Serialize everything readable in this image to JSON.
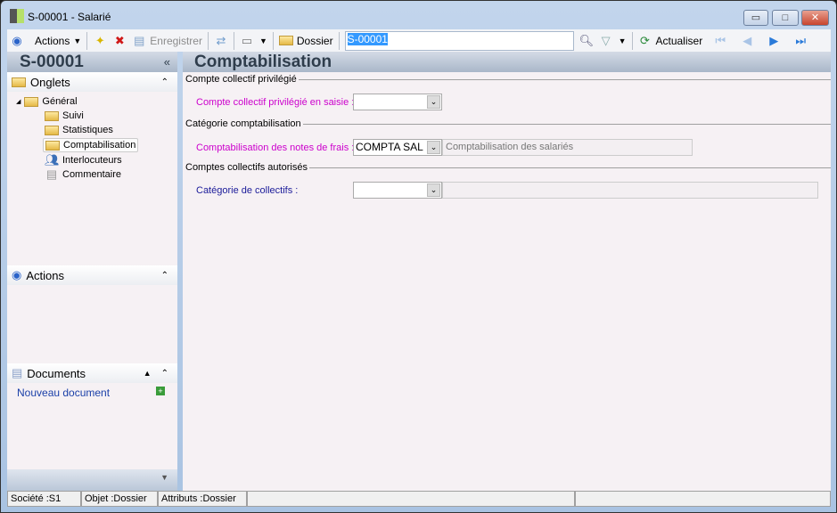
{
  "window": {
    "title": "S-00001 -  Salarié",
    "minimize": "▭",
    "maximize": "□",
    "close": "✕"
  },
  "toolbar": {
    "actions": "Actions",
    "save": "Enregistrer",
    "dossier": "Dossier",
    "search_value": "S-00001",
    "refresh": "Actualiser"
  },
  "left": {
    "record_id": "S-00001",
    "collapse": "«",
    "onglets": "Onglets",
    "tree": [
      "Général",
      "Suivi",
      "Statistiques",
      "Comptabilisation",
      "Interlocuteurs",
      "Commentaire"
    ],
    "actions": "Actions",
    "documents": "Documents",
    "new_document": "Nouveau document"
  },
  "main": {
    "title": "Comptabilisation",
    "groups": [
      "Compte collectif privilégié",
      "Catégorie comptabilisation",
      "Comptes collectifs autorisés"
    ],
    "fields": [
      {
        "label": "Compte collectif privilégié en saisie :",
        "value": "",
        "desc": ""
      },
      {
        "label": "Comptabilisation des notes de frais :",
        "value": "COMPTA SAL",
        "desc": "Comptabilisation des salariés"
      },
      {
        "label": "Catégorie de collectifs :",
        "value": "",
        "desc": ""
      }
    ]
  },
  "status": {
    "societe": "Société :S1",
    "objet": "Objet :Dossier",
    "attributs": "Attributs :Dossier"
  },
  "colors": {
    "pink_label": "#cc00cc",
    "blue_label": "#1a1a99",
    "link": "#1a3fa8"
  }
}
